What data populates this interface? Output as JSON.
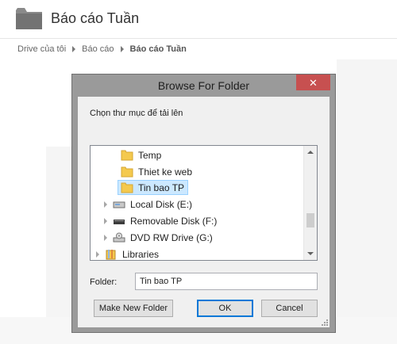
{
  "drive": {
    "page_title": "Báo cáo Tuần",
    "breadcrumb": [
      "Drive của tôi",
      "Báo cáo",
      "Báo cáo Tuần"
    ]
  },
  "dialog": {
    "title": "Browse For Folder",
    "close_label": "✕",
    "description": "Chọn thư mục để tải lên",
    "tree": [
      {
        "label": "Temp",
        "icon": "folder-icon",
        "expander": false,
        "selected": false
      },
      {
        "label": "Thiet ke web",
        "icon": "folder-icon",
        "expander": false,
        "selected": false
      },
      {
        "label": "Tin bao TP",
        "icon": "folder-icon",
        "expander": false,
        "selected": true
      },
      {
        "label": "Local Disk (E:)",
        "icon": "hard-drive-icon",
        "expander": true,
        "selected": false
      },
      {
        "label": "Removable Disk (F:)",
        "icon": "removable-disk-icon",
        "expander": true,
        "selected": false
      },
      {
        "label": "DVD RW Drive (G:)",
        "icon": "dvd-drive-icon",
        "expander": true,
        "selected": false
      },
      {
        "label": "Libraries",
        "icon": "libraries-icon",
        "expander": true,
        "selected": false
      }
    ],
    "folder_label": "Folder:",
    "folder_value": "Tin bao TP",
    "buttons": {
      "make_new_folder": "Make New Folder",
      "ok": "OK",
      "cancel": "Cancel"
    }
  },
  "colors": {
    "close_button": "#c75050",
    "selection": "#cce8ff",
    "default_button_border": "#0078d7",
    "folder_yellow": "#f4c94e"
  }
}
